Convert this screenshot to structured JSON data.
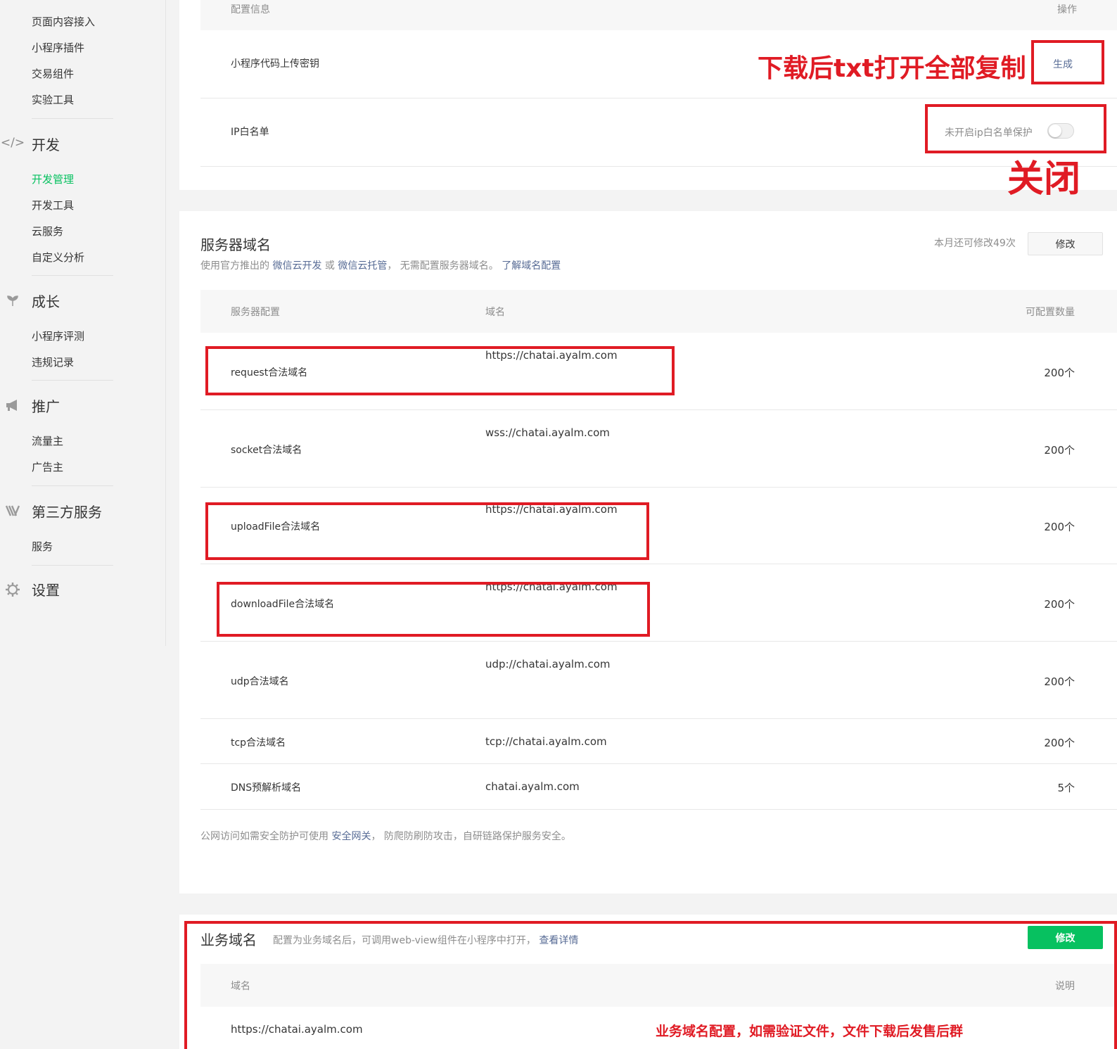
{
  "sidebar": {
    "items_top": [
      "页面内容接入",
      "小程序插件",
      "交易组件",
      "实验工具"
    ],
    "sections": [
      {
        "title": "开发",
        "icon": "code-icon",
        "items": [
          "开发管理",
          "开发工具",
          "云服务",
          "自定义分析"
        ]
      },
      {
        "title": "成长",
        "icon": "sprout-icon",
        "items": [
          "小程序评测",
          "违规记录"
        ]
      },
      {
        "title": "推广",
        "icon": "megaphone-icon",
        "items": [
          "流量主",
          "广告主"
        ]
      },
      {
        "title": "第三方服务",
        "icon": "third-party-icon",
        "items": [
          "服务"
        ]
      },
      {
        "title": "设置",
        "icon": "gear-icon",
        "items": []
      }
    ],
    "active_item": "开发管理"
  },
  "dev_settings": {
    "header_left": "配置信息",
    "header_right": "操作",
    "secret_label": "小程序代码上传密钥",
    "secret_action": "生成",
    "ip_label": "IP白名单",
    "ip_toggle_text": "未开启ip白名单保护",
    "ip_toggle_on": false
  },
  "server_domain": {
    "title": "服务器域名",
    "desc_prefix": "使用官方推出的",
    "desc_link1": "微信云开发",
    "desc_or": "或",
    "desc_link2": "微信云托管",
    "desc_suffix": "，  无需配置服务器域名。",
    "desc_link3": "了解域名配置",
    "remaining": "本月还可修改49次",
    "modify_label": "修改",
    "columns": [
      "服务器配置",
      "域名",
      "可配置数量"
    ],
    "rows": [
      {
        "name": "request合法域名",
        "domain": "https://chatai.ayalm.com",
        "count": "200个"
      },
      {
        "name": "socket合法域名",
        "domain": "wss://chatai.ayalm.com",
        "count": "200个"
      },
      {
        "name": "uploadFile合法域名",
        "domain": "https://chatai.ayalm.com",
        "count": "200个"
      },
      {
        "name": "downloadFile合法域名",
        "domain": "https://chatai.ayalm.com",
        "count": "200个"
      },
      {
        "name": "udp合法域名",
        "domain": "udp://chatai.ayalm.com",
        "count": "200个"
      },
      {
        "name": "tcp合法域名",
        "domain": "tcp://chatai.ayalm.com",
        "count": "200个"
      },
      {
        "name": "DNS预解析域名",
        "domain": "chatai.ayalm.com",
        "count": "5个"
      }
    ],
    "footer_prefix": "公网访问如需安全防护可使用",
    "footer_link": "安全网关",
    "footer_suffix": "，  防爬防刷防攻击，自研链路保护服务安全。"
  },
  "business_domain": {
    "title": "业务域名",
    "desc": "配置为业务域名后，可调用web-view组件在小程序中打开，",
    "desc_link": "查看详情",
    "modify_label": "修改",
    "columns": [
      "域名",
      "说明"
    ],
    "rows": [
      {
        "domain": "https://chatai.ayalm.com"
      }
    ]
  },
  "annotations": {
    "download_note": "下载后txt打开全部复制",
    "close_note": "关闭",
    "business_note": "业务域名配置，如需验证文件，文件下载后发售后群"
  },
  "colors": {
    "accent": "#07c160",
    "link": "#576b95",
    "annotation": "#e01b24"
  }
}
